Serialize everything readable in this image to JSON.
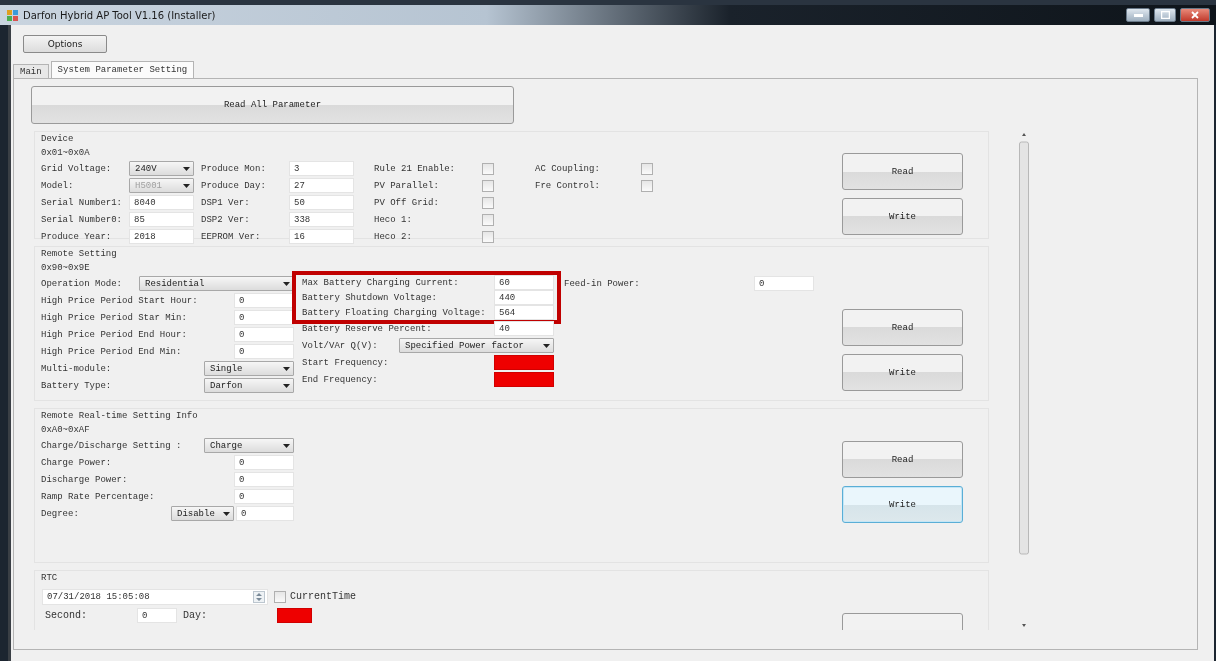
{
  "window": {
    "title": "Darfon Hybrid AP Tool V1.16 (Installer)"
  },
  "options_button": "Options",
  "tabs": [
    {
      "label": "Main",
      "selected": false
    },
    {
      "label": "System Parameter Setting",
      "selected": true
    }
  ],
  "read_all_button": "Read All Parameter",
  "sections": [
    {
      "kind": "device",
      "title": "Device",
      "range": "0x01~0x0A",
      "columns": [
        [
          {
            "label": "Grid Voltage:",
            "kind": "select",
            "value": "240V",
            "disabled": false
          },
          {
            "label": "Model:",
            "kind": "select",
            "value": "H5001",
            "disabled": true
          },
          {
            "label": "Serial Number1:",
            "kind": "input",
            "value": "8040",
            "invalid": false
          },
          {
            "label": "Serial Number0:",
            "kind": "input",
            "value": "85",
            "invalid": false
          },
          {
            "label": "Produce Year:",
            "kind": "input",
            "value": "2018",
            "invalid": false
          }
        ],
        [
          {
            "label": "Produce Mon:",
            "kind": "input",
            "value": "3",
            "invalid": false
          },
          {
            "label": "Produce Day:",
            "kind": "input",
            "value": "27",
            "invalid": false
          },
          {
            "label": "DSP1 Ver:",
            "kind": "input",
            "value": "50",
            "invalid": false
          },
          {
            "label": "DSP2 Ver:",
            "kind": "input",
            "value": "338",
            "invalid": false
          },
          {
            "label": "EEPROM Ver:",
            "kind": "input",
            "value": "16",
            "invalid": false
          }
        ],
        [
          {
            "label": "Rule 21 Enable:",
            "kind": "checkbox",
            "checked": false
          },
          {
            "label": "PV Parallel:",
            "kind": "checkbox",
            "checked": false
          },
          {
            "label": "PV Off Grid:",
            "kind": "checkbox",
            "checked": false
          },
          {
            "label": "Heco 1:",
            "kind": "checkbox",
            "checked": false
          },
          {
            "label": "Heco 2:",
            "kind": "checkbox",
            "checked": false
          }
        ],
        [
          {
            "label": "AC Coupling:",
            "kind": "checkbox",
            "checked": false
          },
          {
            "label": "Fre Control:",
            "kind": "checkbox",
            "checked": false
          }
        ]
      ],
      "buttons": [
        {
          "label": "Read",
          "focused": false
        },
        {
          "label": "Write",
          "focused": false
        }
      ]
    },
    {
      "kind": "remote",
      "title": "Remote Setting",
      "range": "0x90~0x9E",
      "columns": [
        [
          {
            "label": "Operation Mode:",
            "kind": "wide-select",
            "value": "Residential",
            "disabled": false
          },
          {
            "label": "High Price Period Start Hour:",
            "kind": "input",
            "value": "0",
            "invalid": false
          },
          {
            "label": "High Price Period Star Min:",
            "kind": "input",
            "value": "0",
            "invalid": false
          },
          {
            "label": "High Price Period End Hour:",
            "kind": "input",
            "value": "0",
            "invalid": false
          },
          {
            "label": "High Price Period End Min:",
            "kind": "input",
            "value": "0",
            "invalid": false
          },
          {
            "label": "Multi-module:",
            "kind": "select",
            "value": "Single",
            "disabled": false
          },
          {
            "label": "Battery Type:",
            "kind": "select",
            "value": "Darfon",
            "disabled": false
          }
        ],
        [
          {
            "label": "Max Battery Charging Current:",
            "kind": "input",
            "value": "60",
            "invalid": false,
            "highlighted": true
          },
          {
            "label": "Battery Shutdown Voltage:",
            "kind": "input",
            "value": "440",
            "invalid": false,
            "highlighted": true
          },
          {
            "label": "Battery Floating Charging Voltage:",
            "kind": "input",
            "value": "564",
            "invalid": false,
            "highlighted": true
          },
          {
            "label": "Battery Reserve Percent:",
            "kind": "input",
            "value": "40",
            "invalid": false,
            "highlighted": false
          },
          {
            "label": "Volt/VAr Q(V):",
            "kind": "wide-select",
            "value": "Specified Power factor",
            "disabled": false,
            "highlighted": false
          },
          {
            "label": "Start Frequency:",
            "kind": "input",
            "invalid": true,
            "highlighted": false
          },
          {
            "label": "End Frequency:",
            "kind": "input",
            "invalid": true,
            "highlighted": false
          }
        ],
        [
          {
            "label": "Feed-in Power:",
            "kind": "input",
            "value": "0",
            "invalid": false
          }
        ]
      ],
      "buttons": [
        {
          "label": "Read",
          "focused": false
        },
        {
          "label": "Write",
          "focused": false
        }
      ]
    },
    {
      "kind": "realtime",
      "title": "Remote Real-time Setting Info",
      "range": "0xA0~0xAF",
      "columns": [
        [
          {
            "label": "Charge/Discharge Setting :",
            "kind": "select",
            "value": "Charge",
            "disabled": false
          },
          {
            "label": "Charge Power:",
            "kind": "input",
            "value": "0",
            "invalid": false
          },
          {
            "label": "Discharge Power:",
            "kind": "input",
            "value": "0",
            "invalid": false
          },
          {
            "label": "Ramp Rate Percentage:",
            "kind": "input",
            "value": "0",
            "invalid": false
          },
          {
            "label": "Degree:",
            "kind": "select-input",
            "value": "Disable",
            "input_value": "0",
            "disabled": false
          }
        ]
      ],
      "buttons": [
        {
          "label": "Read",
          "focused": false
        },
        {
          "label": "Write",
          "focused": true
        }
      ]
    },
    {
      "kind": "rtc",
      "title": "RTC",
      "datetime": "07/31/2018 15:05:08",
      "current_time": {
        "label": "CurrentTime",
        "checked": false
      },
      "second": {
        "label": "Second:",
        "value": "0",
        "invalid": false
      },
      "day": {
        "label": "Day:",
        "invalid": true
      },
      "buttons": [
        {
          "focused": false
        }
      ]
    }
  ]
}
